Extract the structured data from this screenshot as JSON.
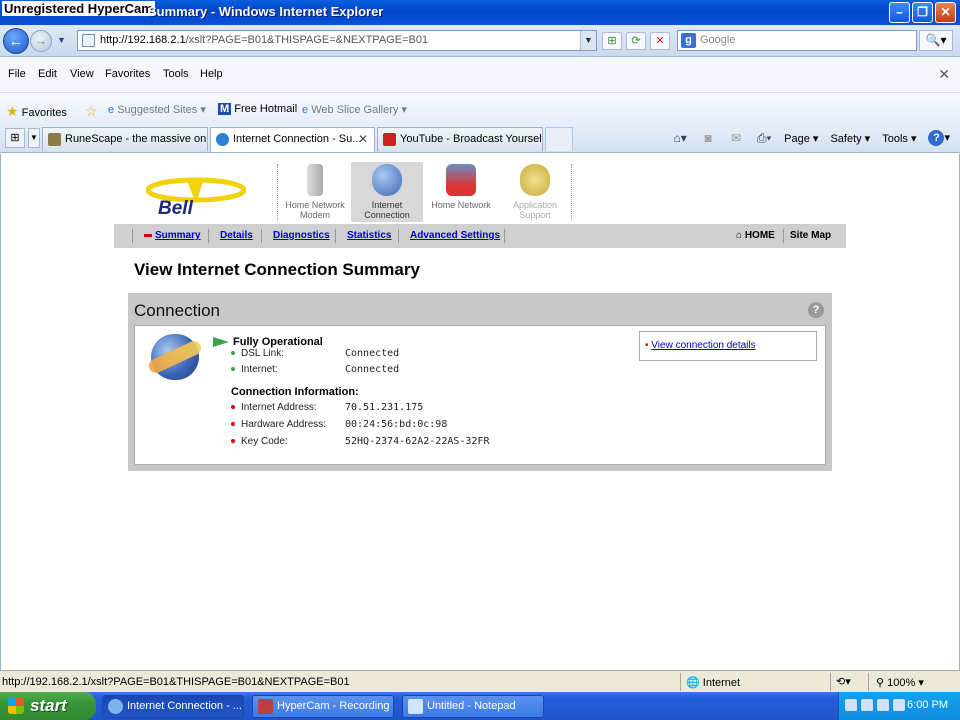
{
  "window": {
    "watermark": "Unregistered HyperCam",
    "title": "Summary - Windows Internet Explorer"
  },
  "address": {
    "url_host": "http://192.168.2.1",
    "url_rest": "/xslt?PAGE=B01&THISPAGE=&NEXTPAGE=B01",
    "search_placeholder": "Google"
  },
  "menu": [
    "File",
    "Edit",
    "View",
    "Favorites",
    "Tools",
    "Help"
  ],
  "favorites": {
    "label": "Favorites",
    "items": [
      "Suggested Sites ▾",
      "Free Hotmail",
      "Web Slice Gallery ▾"
    ]
  },
  "tabs": [
    {
      "label": "RuneScape - the massive onli..."
    },
    {
      "label": "Internet Connection - Su..."
    },
    {
      "label": "YouTube - Broadcast Yourself."
    }
  ],
  "command": {
    "page": "Page ▾",
    "safety": "Safety ▾",
    "tools": "Tools ▾"
  },
  "router": {
    "brand": "Bell",
    "topnav": [
      {
        "label": "Home Network Modem"
      },
      {
        "label": "Internet Connection"
      },
      {
        "label": "Home Network"
      },
      {
        "label": "Application Support"
      }
    ],
    "subnav": [
      "Summary",
      "Details",
      "Diagnostics",
      "Statistics",
      "Advanced Settings"
    ],
    "home": "HOME",
    "sitemap": "Site Map",
    "page_title": "View Internet Connection Summary",
    "panel_title": "Connection",
    "status": "Fully Operational",
    "links": [
      {
        "label": "DSL Link:",
        "value": "Connected"
      },
      {
        "label": "Internet:",
        "value": "Connected"
      }
    ],
    "info_title": "Connection Information:",
    "info": [
      {
        "label": "Internet Address:",
        "value": "70.51.231.175"
      },
      {
        "label": "Hardware Address:",
        "value": "00:24:56:bd:0c:98"
      },
      {
        "label": "Key Code:",
        "value": "52HQ-2374-62A2-22AS-32FR"
      }
    ],
    "details_link": "View connection details"
  },
  "statusbar": {
    "url": "http://192.168.2.1/xslt?PAGE=B01&THISPAGE=B01&NEXTPAGE=B01",
    "zone": "Internet",
    "zoom": "100%"
  },
  "taskbar": {
    "start": "start",
    "tasks": [
      "Internet Connection - ...",
      "HyperCam - Recording",
      "Untitled - Notepad"
    ],
    "clock": "6:00 PM"
  },
  "colors": {
    "accent_blue": "#0000cc",
    "status_green": "#3aa34a",
    "bullet_red": "#dd0000",
    "bullet_green": "#33aa44"
  }
}
